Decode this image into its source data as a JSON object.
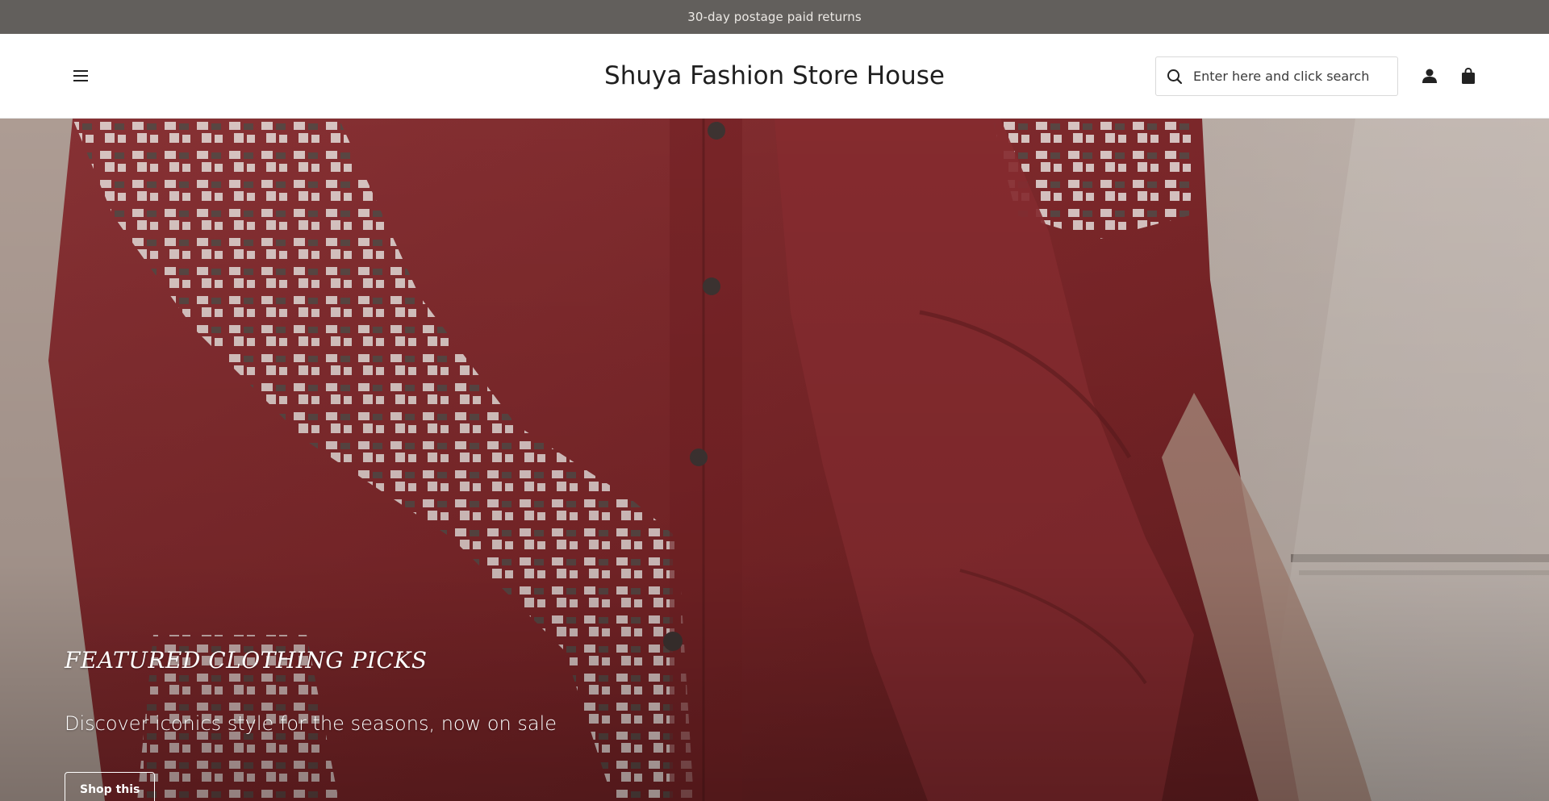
{
  "announcement": {
    "text": "30-day postage paid returns"
  },
  "header": {
    "brand": "Shuya Fashion Store House",
    "search": {
      "placeholder": "Enter here and click search",
      "value": ""
    },
    "icons": {
      "menu": "hamburger-menu-icon",
      "search": "search-icon",
      "account": "user-icon",
      "cart": "shopping-bag-icon"
    }
  },
  "hero": {
    "title": "FEATURED CLOTHING PICKS",
    "subtitle": "Discover iconics style for the seasons, now on sale",
    "button_label": "Shop this"
  },
  "colors": {
    "announcement_bg": "#625f5c",
    "sweater_red": "#8a2e31",
    "pattern_white": "#e8d9d6",
    "pattern_gray": "#5a4c48",
    "background_beige": "#b9aca3"
  }
}
